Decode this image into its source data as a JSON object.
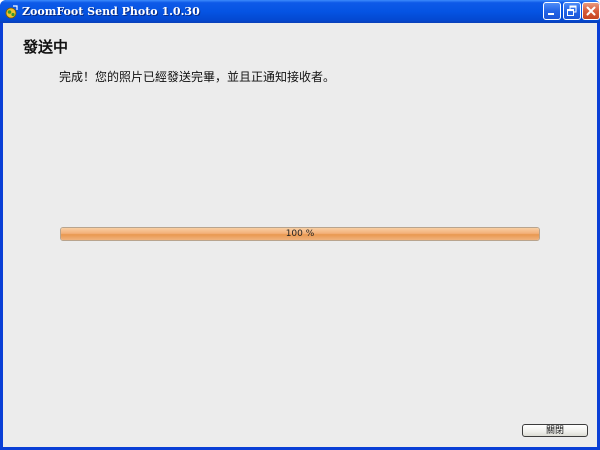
{
  "window": {
    "title": "ZoomFoot Send Photo 1.0.30",
    "icon": "zoomfoot-app-icon",
    "controls": [
      "minimize-icon",
      "restore-icon",
      "close-icon"
    ]
  },
  "main": {
    "heading": "發送中",
    "message": "完成！您的照片已經發送完畢，並且正通知接收者。"
  },
  "progress": {
    "value_percent": 100,
    "label": "100 %"
  },
  "footer": {
    "close_label": "關閉"
  },
  "colors": {
    "titlebar": "#0554e3",
    "client_background": "#ececec",
    "progress_fill": "#f0ad72"
  }
}
